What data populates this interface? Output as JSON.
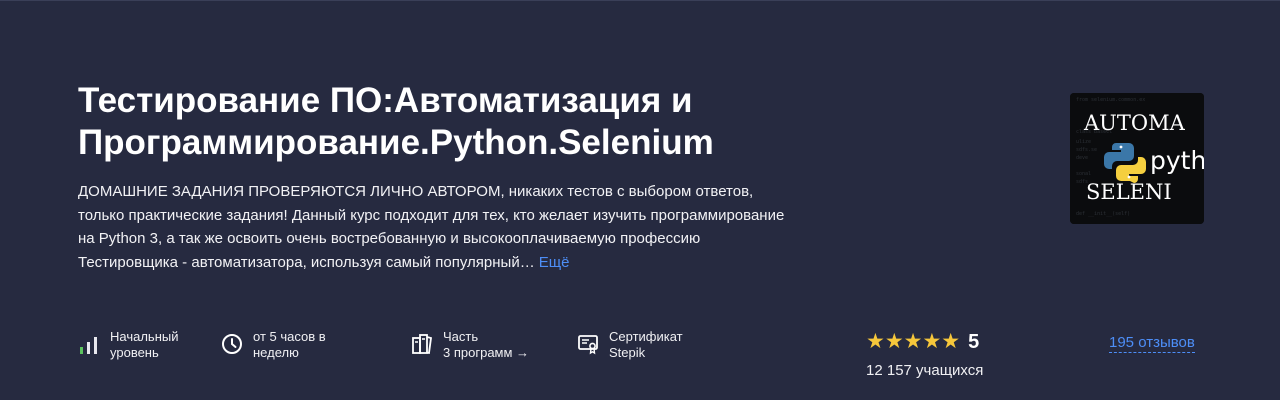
{
  "course": {
    "title_line1": "Тестирование ПО:Автоматизация и",
    "title_line2": "Программирование.Python.Selenium",
    "summary": "ДОМАШНИЕ ЗАДАНИЯ ПРОВЕРЯЮТСЯ ЛИЧНО АВТОРОМ, никаких тестов с выбором ответов, только практические задания! Данный курс подходит для тех, кто желает изучить программирование на Python 3, а так же освоить очень востребованную и высокооплачиваемую профессию Тестировщика - автоматизатора, используя самый популярный…",
    "more_link": "Ещё"
  },
  "cover": {
    "line1": "AUTOMA",
    "line2": "pyth",
    "line3": "SELENI"
  },
  "facts": [
    {
      "icon": "level-bars-icon",
      "line1": "Начальный",
      "line2": "уровень"
    },
    {
      "icon": "clock-icon",
      "line1": "от 5 часов в",
      "line2": "неделю"
    },
    {
      "icon": "books-icon",
      "line1": "Часть",
      "line2": "3 программ →"
    },
    {
      "icon": "certificate-icon",
      "line1": "Сертификат",
      "line2": "Stepik"
    }
  ],
  "rating": {
    "stars": "★★★★★",
    "value": "5",
    "learners": "12 157 учащихся",
    "reviews": "195 отзывов"
  },
  "colors": {
    "background": "#262a40",
    "link": "#4d8ef7",
    "star": "#f6c73b",
    "level_green": "#5cc35f"
  }
}
